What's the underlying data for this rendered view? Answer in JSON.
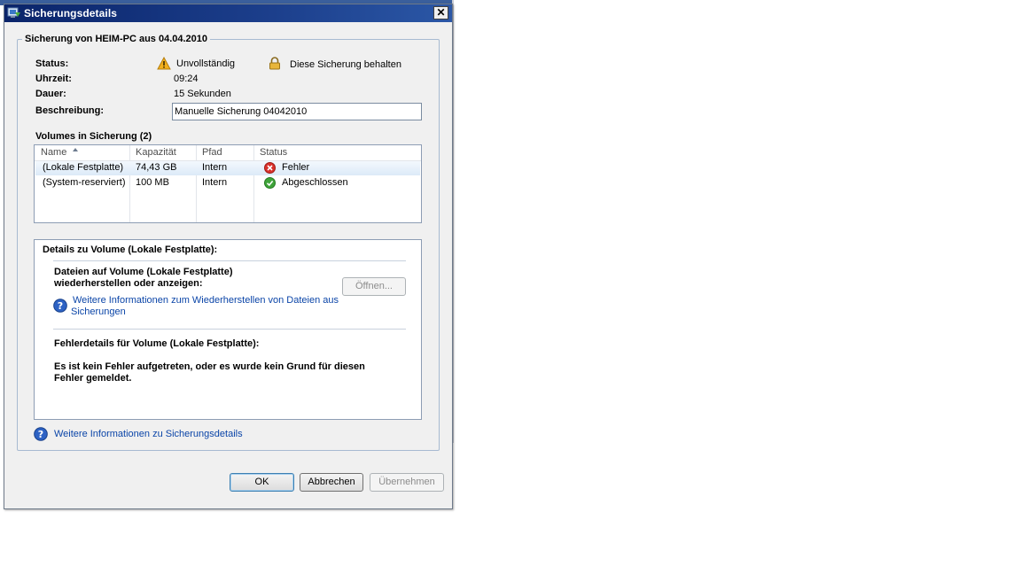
{
  "window": {
    "title": "Sicherungsdetails",
    "close_label": "✕"
  },
  "backup": {
    "heading": "Sicherung von HEIM-PC aus 04.04.2010",
    "status_label": "Status:",
    "status_value": "Unvollständig",
    "keep_label": "Diese Sicherung behalten",
    "time_label": "Uhrzeit:",
    "time_value": "09:24",
    "duration_label": "Dauer:",
    "duration_value": "15 Sekunden",
    "description_label": "Beschreibung:",
    "description_value": "Manuelle Sicherung 04042010"
  },
  "volumes": {
    "heading": "Volumes in Sicherung (2)",
    "columns": [
      "Name",
      "Kapazität",
      "Pfad",
      "Status"
    ],
    "rows": [
      {
        "name": "(Lokale Festplatte)",
        "capacity": "74,43 GB",
        "path": "Intern",
        "status": "Fehler",
        "status_icon": "error-icon",
        "selected": true
      },
      {
        "name": "(System-reserviert)",
        "capacity": "100 MB",
        "path": "Intern",
        "status": "Abgeschlossen",
        "status_icon": "success-icon",
        "selected": false
      }
    ]
  },
  "details": {
    "heading": "Details zu Volume  (Lokale Festplatte):",
    "files_line1": "Dateien auf Volume  (Lokale Festplatte)",
    "files_line2": "wiederherstellen oder anzeigen:",
    "open_button": "Öffnen...",
    "restore_link_line1": "Weitere Informationen zum Wiederherstellen von Dateien aus",
    "restore_link_line2": "Sicherungen",
    "error_heading": "Fehlerdetails für Volume  (Lokale Festplatte):",
    "error_line1": "Es ist kein Fehler aufgetreten, oder es wurde kein Grund für diesen",
    "error_line2": "Fehler gemeldet."
  },
  "footer": {
    "info_link": "Weitere Informationen zu Sicherungsdetails",
    "ok": "OK",
    "cancel": "Abbrechen",
    "apply": "Übernehmen"
  },
  "colors": {
    "title_bar": "#0a246a",
    "link": "#0b45a8",
    "selected_row": "#dceaf8",
    "error_red": "#d9312b",
    "success_green": "#3fa33a",
    "warning_amber": "#f2b01e"
  }
}
